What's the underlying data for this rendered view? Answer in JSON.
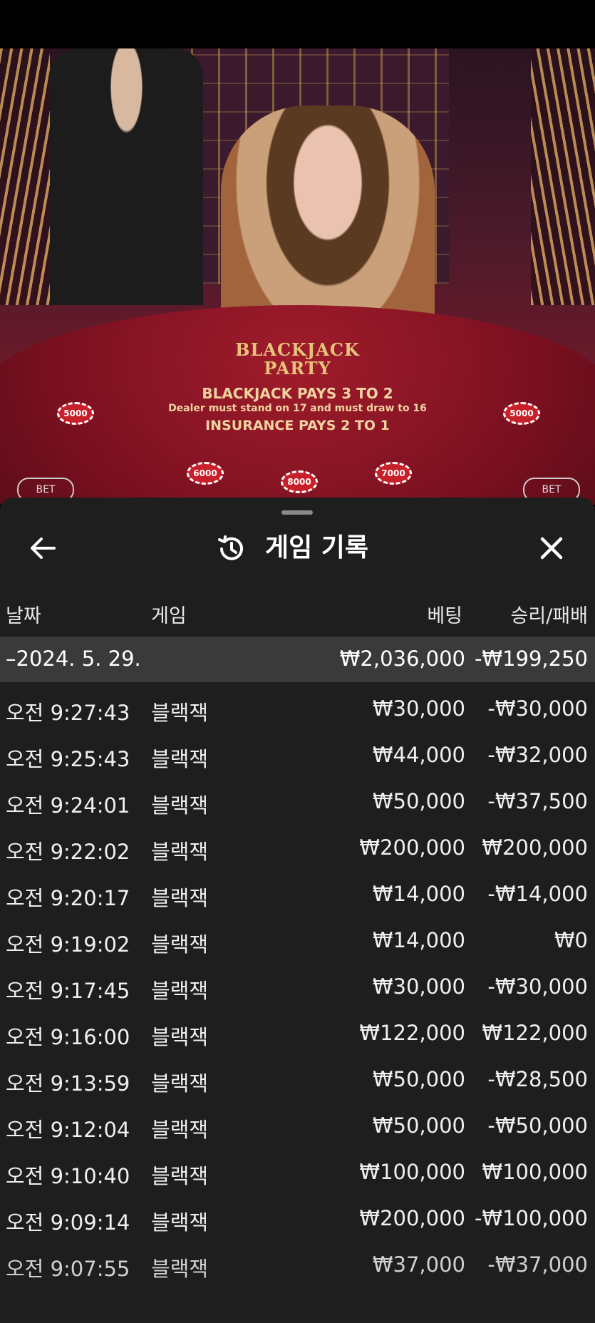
{
  "header": {
    "title": "게임 기록",
    "back_icon": "arrow-left-icon",
    "history_icon": "history-clock-icon",
    "close_icon": "close-x-icon"
  },
  "columns": {
    "date": "날짜",
    "game": "게임",
    "bet": "베팅",
    "result": "승리/패배"
  },
  "date_group": {
    "date": "–2024. 5. 29.",
    "total_bet": "₩2,036,000",
    "total_result": "-₩199,250"
  },
  "rows": [
    {
      "time": "오전 9:27:43",
      "game": "블랙잭",
      "bet": "₩30,000",
      "result": "-₩30,000"
    },
    {
      "time": "오전 9:25:43",
      "game": "블랙잭",
      "bet": "₩44,000",
      "result": "-₩32,000"
    },
    {
      "time": "오전 9:24:01",
      "game": "블랙잭",
      "bet": "₩50,000",
      "result": "-₩37,500"
    },
    {
      "time": "오전 9:22:02",
      "game": "블랙잭",
      "bet": "₩200,000",
      "result": "₩200,000"
    },
    {
      "time": "오전 9:20:17",
      "game": "블랙잭",
      "bet": "₩14,000",
      "result": "-₩14,000"
    },
    {
      "time": "오전 9:19:02",
      "game": "블랙잭",
      "bet": "₩14,000",
      "result": "₩0"
    },
    {
      "time": "오전 9:17:45",
      "game": "블랙잭",
      "bet": "₩30,000",
      "result": "-₩30,000"
    },
    {
      "time": "오전 9:16:00",
      "game": "블랙잭",
      "bet": "₩122,000",
      "result": "₩122,000"
    },
    {
      "time": "오전 9:13:59",
      "game": "블랙잭",
      "bet": "₩50,000",
      "result": "-₩28,500"
    },
    {
      "time": "오전 9:12:04",
      "game": "블랙잭",
      "bet": "₩50,000",
      "result": "-₩50,000"
    },
    {
      "time": "오전 9:10:40",
      "game": "블랙잭",
      "bet": "₩100,000",
      "result": "₩100,000"
    },
    {
      "time": "오전 9:09:14",
      "game": "블랙잭",
      "bet": "₩200,000",
      "result": "-₩100,000"
    },
    {
      "time": "오전 9:07:55",
      "game": "블랙잭",
      "bet": "₩37,000",
      "result": "-₩37,000"
    }
  ],
  "video": {
    "logo_line1": "BLACKJACK",
    "logo_line2": "PARTY",
    "line1": "BLACKJACK PAYS 3 TO 2",
    "line2": "Dealer must stand on 17 and must draw to 16",
    "line3": "INSURANCE PAYS 2 TO 1",
    "chips": [
      "5000",
      "6000",
      "8000",
      "7000",
      "5000"
    ],
    "bet_label": "BET"
  }
}
